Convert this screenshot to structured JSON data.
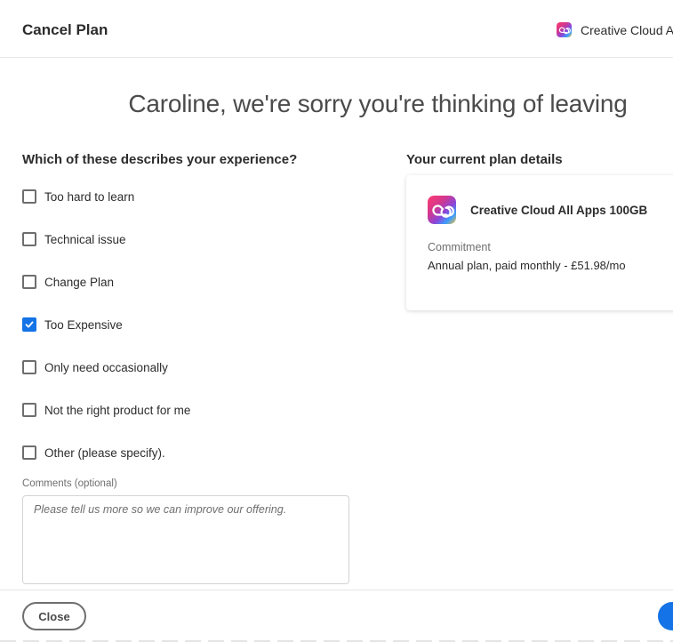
{
  "header": {
    "title": "Cancel Plan",
    "product_label": "Creative Cloud All"
  },
  "main": {
    "heading": "Caroline, we're sorry you're thinking of leaving"
  },
  "survey": {
    "question": "Which of these describes your experience?",
    "options": [
      {
        "label": "Too hard to learn",
        "checked": false
      },
      {
        "label": "Technical issue",
        "checked": false
      },
      {
        "label": "Change Plan",
        "checked": false
      },
      {
        "label": "Too Expensive",
        "checked": true
      },
      {
        "label": "Only need occasionally",
        "checked": false
      },
      {
        "label": "Not the right product for me",
        "checked": false
      },
      {
        "label": "Other (please specify).",
        "checked": false
      }
    ],
    "comments_label": "Comments (optional)",
    "comments_placeholder": "Please tell us more so we can improve our offering.",
    "comments_value": ""
  },
  "plan": {
    "heading": "Your current plan details",
    "name": "Creative Cloud All Apps 100GB",
    "commitment_label": "Commitment",
    "commitment_value": "Annual plan, paid monthly - £51.98/mo",
    "icon": "creative-cloud-icon"
  },
  "footer": {
    "close_label": "Close"
  },
  "colors": {
    "accent": "#1473e6",
    "text": "#2c2c2c",
    "muted": "#6e6e6e",
    "divider": "#e6e6e6"
  }
}
